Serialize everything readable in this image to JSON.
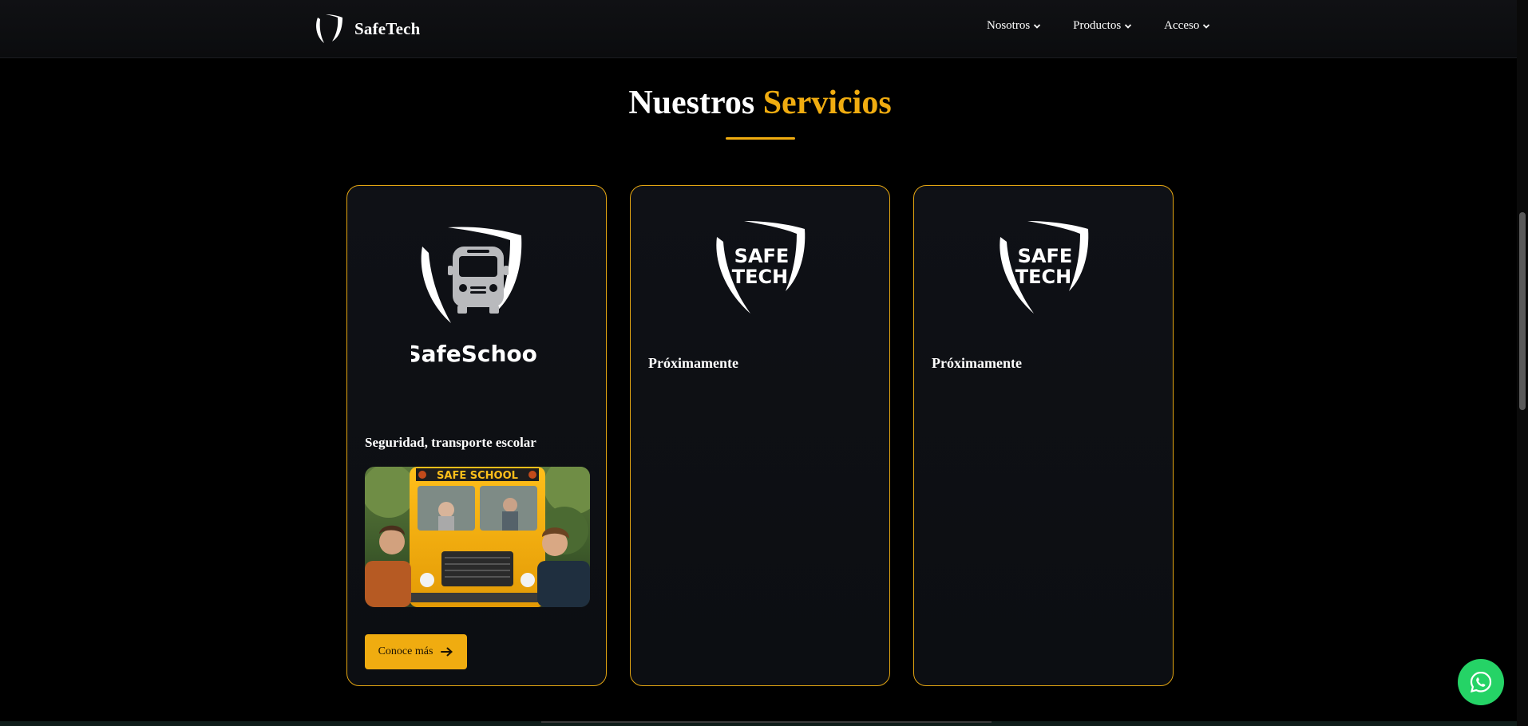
{
  "colors": {
    "accent": "#f0ac10",
    "card_border": "#e3a512",
    "background": "#000000",
    "card_background": "#0f1116",
    "whatsapp": "#25d366"
  },
  "navbar": {
    "brand_name": "SafeTech",
    "logo_icon": "shield-logo-icon",
    "menu": [
      {
        "label": "Nosotros",
        "icon": "chevron-down-icon"
      },
      {
        "label": "Productos",
        "icon": "chevron-down-icon"
      },
      {
        "label": "Acceso",
        "icon": "chevron-down-icon"
      }
    ]
  },
  "section": {
    "title_part1": "Nuestros",
    "title_part2": "Servicios"
  },
  "cards": [
    {
      "logo_text": "SafeSchool",
      "logo_icon": "shield-bus-icon",
      "subtitle": "Seguridad, transporte escolar",
      "image_icon": "school-bus-photo",
      "image_sign_text": "SAFE SCHOOL",
      "button_label": "Conoce más",
      "button_icon": "arrow-right-icon"
    },
    {
      "logo_text_line1": "SAFE",
      "logo_text_line2": "TECH",
      "logo_icon": "safetech-shield-icon",
      "status": "Próximamente"
    },
    {
      "logo_text_line1": "SAFE",
      "logo_text_line2": "TECH",
      "logo_icon": "safetech-shield-icon",
      "status": "Próximamente"
    }
  ],
  "whatsapp": {
    "icon": "whatsapp-icon"
  }
}
